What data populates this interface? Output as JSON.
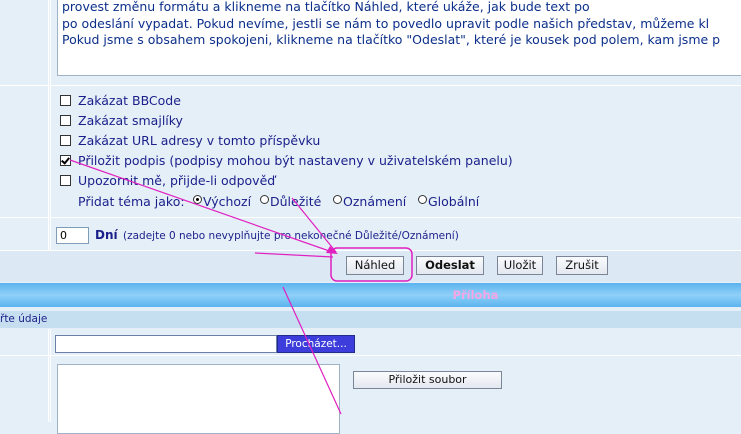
{
  "message": {
    "lines": [
      "provest změnu formátu a klikneme na tlačítko Náhled, které ukáže, jak bude text po",
      "po odeslání vypadat. Pokud nevíme, jestli se nám to povedlo upravit podle našich představ, můžeme kl",
      "Pokud jsme s obsahem spokojeni, klikneme na tlačítko \"Odeslat\", které je kousek pod polem, kam jsme p"
    ]
  },
  "options": {
    "disable_bbcode": "Zakázat BBCode",
    "disable_smilies": "Zakázat smajlíky",
    "disable_urls": "Zakázat URL adresy v tomto příspěvku",
    "attach_signature": "Přiložit podpis (podpisy mohou být nastaveny v uživatelském panelu)",
    "notify_reply": "Upozornit mě, přijde-li odpověď",
    "topic_type_label": "Přidat téma jako:",
    "topic_types": [
      "Výchozí",
      "Důležité",
      "Oznámení",
      "Globální"
    ],
    "topic_type_selected": "Výchozí"
  },
  "duration": {
    "value": "0",
    "label": "Dní",
    "hint": "(zadejte 0 nebo nevyplňujte pro nekonečné Důležité/Oznámení)"
  },
  "buttons": {
    "preview": "Náhled",
    "submit": "Odeslat",
    "save": "Uložit",
    "cancel": "Zrušit"
  },
  "attachment": {
    "header": "Příloha",
    "subheader": "řte údaje",
    "browse": "Procházet...",
    "attach_file": "Přiložit soubor"
  },
  "colors": {
    "annotation": "#e020c0",
    "header_text": "#f5a6e6"
  }
}
